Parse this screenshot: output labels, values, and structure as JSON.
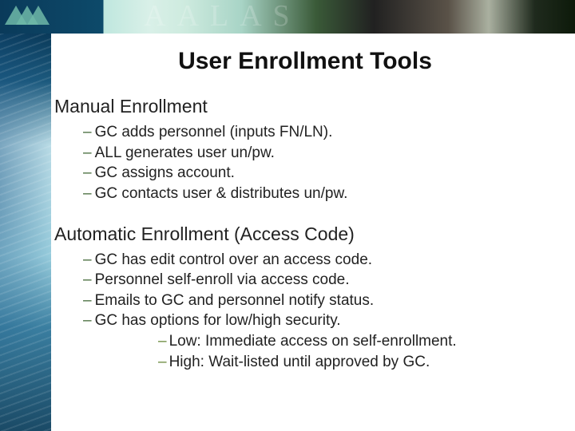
{
  "banner": {
    "logo_label": "AALAS logo",
    "watermark_text": "AALAS"
  },
  "title": "User Enrollment Tools",
  "sections": [
    {
      "heading": "Manual Enrollment",
      "items": [
        "GC adds personnel (inputs FN/LN).",
        "ALL generates user un/pw.",
        "GC assigns account.",
        "GC contacts user & distributes un/pw."
      ]
    },
    {
      "heading": "Automatic Enrollment (Access Code)",
      "items": [
        "GC has edit control over an access code.",
        "Personnel self-enroll via access code.",
        "Emails to GC and personnel notify status.",
        "GC has options for low/high security."
      ],
      "subitems": [
        "Low: Immediate access on self-enrollment.",
        "High: Wait-listed until approved by GC."
      ]
    }
  ],
  "bullets": {
    "level1": "–",
    "level2": "–"
  }
}
